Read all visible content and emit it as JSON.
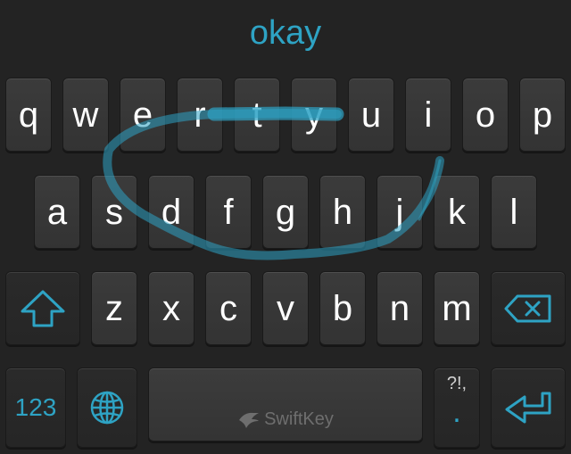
{
  "suggestion": {
    "word": "okay"
  },
  "keyboard": {
    "row1": [
      "q",
      "w",
      "e",
      "r",
      "t",
      "y",
      "u",
      "i",
      "o",
      "p"
    ],
    "row2": [
      "a",
      "s",
      "d",
      "f",
      "g",
      "h",
      "j",
      "k",
      "l"
    ],
    "row3": [
      "z",
      "x",
      "c",
      "v",
      "b",
      "n",
      "m"
    ],
    "bottom": {
      "numbers_label": "123",
      "punct_label": "?!,",
      "period_label": ".",
      "brand_text": "SwiftKey"
    }
  },
  "colors": {
    "accent": "#2ea3c4",
    "background": "#232323",
    "key": "#363636"
  }
}
